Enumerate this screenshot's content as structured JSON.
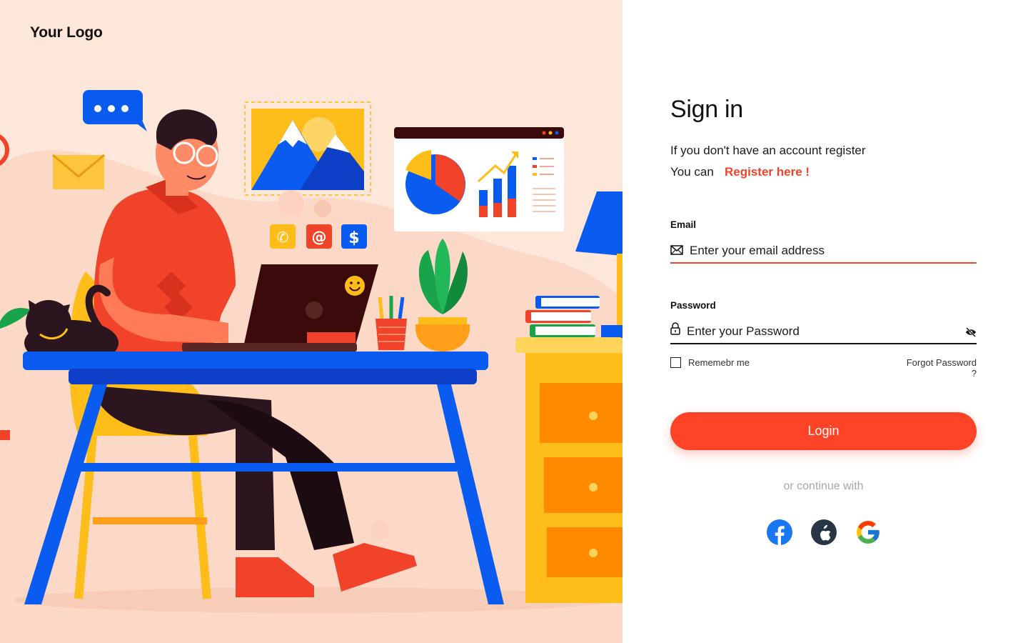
{
  "brand": {
    "logo_text": "Your Logo"
  },
  "signin": {
    "title": "Sign in",
    "subtitle_line1": "If you don't have an account register",
    "subtitle_line2": "You can",
    "register_link": "Register here !"
  },
  "form": {
    "email_label": "Email",
    "email_placeholder": "Enter your email address",
    "password_label": "Password",
    "password_placeholder": "Enter your Password",
    "remember_label": "Rememebr me",
    "forgot_label": "Forgot Password ?",
    "login_label": "Login"
  },
  "social": {
    "continue_text": "or continue with",
    "providers": [
      {
        "name": "facebook",
        "icon": "facebook-icon",
        "color": "#1877F2"
      },
      {
        "name": "apple",
        "icon": "apple-icon",
        "color": "#283544"
      },
      {
        "name": "google",
        "icon": "google-icon",
        "color": "#4285F4"
      }
    ]
  },
  "colors": {
    "accent": "#ff4326",
    "left_bg": "#fde6da"
  }
}
